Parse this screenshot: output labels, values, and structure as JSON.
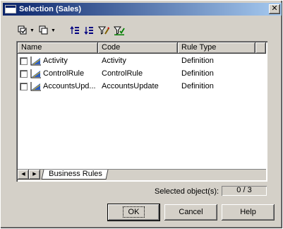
{
  "window": {
    "title": "Selection (Sales)"
  },
  "toolbar": {
    "items": [
      {
        "icon": "select-all-icon",
        "has_dropdown": true
      },
      {
        "icon": "deselect-all-icon",
        "has_dropdown": true
      },
      {
        "icon": "move-up-icon"
      },
      {
        "icon": "move-down-icon"
      },
      {
        "icon": "filter-icon"
      },
      {
        "icon": "apply-filter-icon"
      }
    ]
  },
  "list": {
    "columns": [
      "Name",
      "Code",
      "Rule Type"
    ],
    "rows": [
      {
        "name": "Activity",
        "code": "Activity",
        "type": "Definition",
        "checked": false
      },
      {
        "name": "ControlRule",
        "code": "ControlRule",
        "type": "Definition",
        "checked": false
      },
      {
        "name": "AccountsUpd...",
        "code": "AccountsUpdate",
        "type": "Definition",
        "checked": false
      }
    ],
    "tab": "Business Rules"
  },
  "selection": {
    "label": "Selected object(s):",
    "value": "0 / 3"
  },
  "buttons": {
    "ok": "OK",
    "cancel": "Cancel",
    "help": "Help"
  },
  "colors": {
    "title_start": "#0a246a",
    "title_end": "#a6caf0",
    "face": "#d4d0c8",
    "rule_icon": "#3060c0"
  }
}
